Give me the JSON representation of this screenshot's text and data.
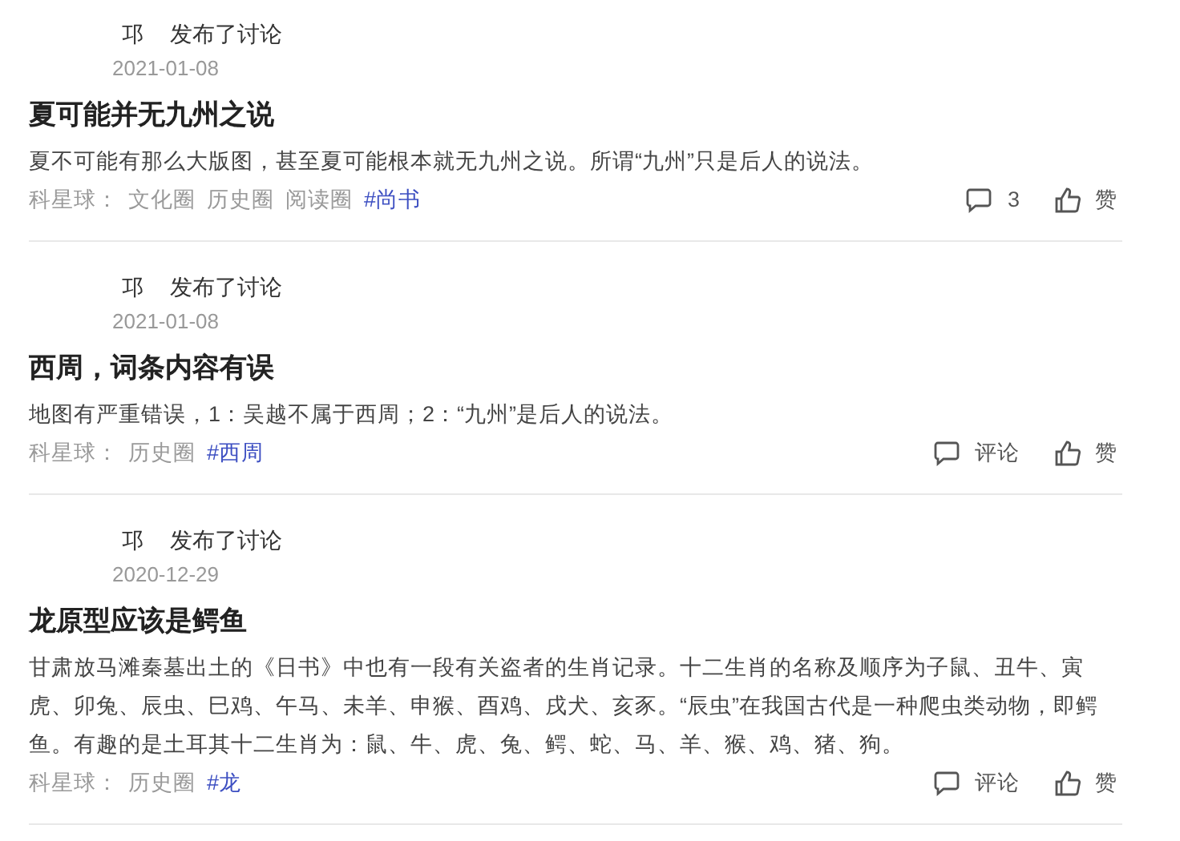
{
  "posts": [
    {
      "author": "邛",
      "action": "发布了讨论",
      "date": "2021-01-08",
      "title": "夏可能并无九州之说",
      "body": "夏不可能有那么大版图，甚至夏可能根本就无九州之说。所谓“九州”只是后人的说法。",
      "source_label": "科星球：",
      "tags": [
        {
          "text": "文化圈",
          "kind": "circle"
        },
        {
          "text": "历史圈",
          "kind": "circle"
        },
        {
          "text": "阅读圈",
          "kind": "circle"
        },
        {
          "text": "#尚书",
          "kind": "topic"
        }
      ],
      "comment": "3",
      "like": "赞"
    },
    {
      "author": "邛",
      "action": "发布了讨论",
      "date": "2021-01-08",
      "title": "西周，词条内容有误",
      "body": "地图有严重错误，1：吴越不属于西周；2：“九州”是后人的说法。",
      "source_label": "科星球：",
      "tags": [
        {
          "text": "历史圈",
          "kind": "circle"
        },
        {
          "text": "#西周",
          "kind": "topic"
        }
      ],
      "comment": "评论",
      "like": "赞"
    },
    {
      "author": "邛",
      "action": "发布了讨论",
      "date": "2020-12-29",
      "title": "龙原型应该是鳄鱼",
      "body": "甘肃放马滩秦墓出土的《日书》中也有一段有关盗者的生肖记录。十二生肖的名称及顺序为子鼠、丑牛、寅虎、卯兔、辰虫、巳鸡、午马、未羊、申猴、酉鸡、戌犬、亥豕。“辰虫”在我国古代是一种爬虫类动物，即鳄鱼。有趣的是土耳其十二生肖为：鼠、牛、虎、兔、鳄、蛇、马、羊、猴、鸡、猪、狗。",
      "source_label": "科星球：",
      "tags": [
        {
          "text": "历史圈",
          "kind": "circle"
        },
        {
          "text": "#龙",
          "kind": "topic"
        }
      ],
      "comment": "评论",
      "like": "赞"
    }
  ]
}
